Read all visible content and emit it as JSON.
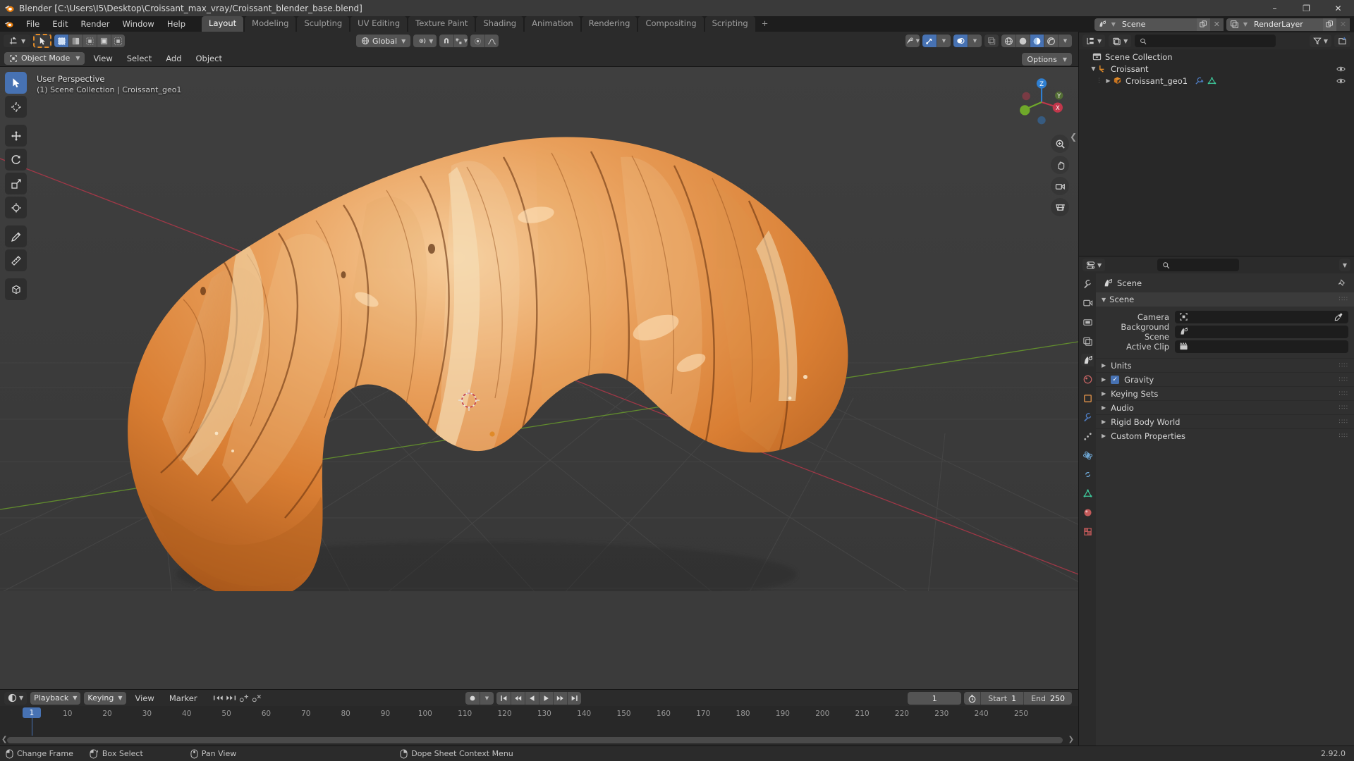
{
  "window": {
    "title": "Blender [C:\\Users\\I5\\Desktop\\Croissant_max_vray/Croissant_blender_base.blend]",
    "minimize": "–",
    "maximize": "❐",
    "close": "✕"
  },
  "menubar": {
    "items": [
      "File",
      "Edit",
      "Render",
      "Window",
      "Help"
    ],
    "tabs": [
      {
        "label": "Layout",
        "active": true
      },
      {
        "label": "Modeling",
        "active": false
      },
      {
        "label": "Sculpting",
        "active": false
      },
      {
        "label": "UV Editing",
        "active": false
      },
      {
        "label": "Texture Paint",
        "active": false
      },
      {
        "label": "Shading",
        "active": false
      },
      {
        "label": "Animation",
        "active": false
      },
      {
        "label": "Rendering",
        "active": false
      },
      {
        "label": "Compositing",
        "active": false
      },
      {
        "label": "Scripting",
        "active": false
      }
    ],
    "add_tab": "+"
  },
  "viewport": {
    "mode": "Object Mode",
    "menus": [
      "View",
      "Select",
      "Add",
      "Object"
    ],
    "transform_orientation": "Global",
    "options_label": "Options",
    "overlay_line1": "User Perspective",
    "overlay_line2": "(1) Scene Collection | Croissant_geo1",
    "gizmo_axes": {
      "x": "X",
      "y": "Y",
      "z": "Z"
    }
  },
  "timeline": {
    "editor_menus": [
      "Playback",
      "Keying",
      "View",
      "Marker"
    ],
    "current_frame": "1",
    "start_label": "Start",
    "start_value": "1",
    "end_label": "End",
    "end_value": "250",
    "playhead_frame": "1",
    "ticks": [
      10,
      20,
      30,
      40,
      50,
      60,
      70,
      80,
      90,
      100,
      110,
      120,
      130,
      140,
      150,
      160,
      170,
      180,
      190,
      200,
      210,
      220,
      230,
      240,
      250
    ]
  },
  "topbar_right": {
    "scene_name": "Scene",
    "view_layer_name": "RenderLayer"
  },
  "outliner": {
    "search_placeholder": "",
    "rows": [
      {
        "label": "Scene Collection",
        "indent": 0,
        "type": "collection",
        "expanded": true,
        "eye": false
      },
      {
        "label": "Croissant",
        "indent": 1,
        "type": "collection-child",
        "expanded": true,
        "eye": true
      },
      {
        "label": "Croissant_geo1",
        "indent": 2,
        "type": "mesh",
        "expanded": false,
        "eye": true
      }
    ]
  },
  "properties": {
    "breadcrumb": "Scene",
    "panel_title": "Scene",
    "fields": [
      {
        "label": "Camera",
        "value": "",
        "icon": "camera-icon"
      },
      {
        "label": "Background Scene",
        "value": "",
        "icon": "scene-icon"
      },
      {
        "label": "Active Clip",
        "value": "",
        "icon": "clip-icon"
      }
    ],
    "sections": [
      {
        "label": "Units",
        "checkbox": null
      },
      {
        "label": "Gravity",
        "checkbox": true
      },
      {
        "label": "Keying Sets",
        "checkbox": null
      },
      {
        "label": "Audio",
        "checkbox": null
      },
      {
        "label": "Rigid Body World",
        "checkbox": null
      },
      {
        "label": "Custom Properties",
        "checkbox": null
      }
    ]
  },
  "statusbar": {
    "items": [
      "Change Frame",
      "Box Select",
      "Pan View",
      "Dope Sheet Context Menu"
    ],
    "version": "2.92.0"
  },
  "colors": {
    "accent": "#4772b3",
    "orange": "#e08a28",
    "axis_x": "#c1374b",
    "axis_y": "#6fa82a",
    "axis_z": "#2f7fd1",
    "bg_dark": "#1d1d1d",
    "bg_panel": "#303030",
    "viewport_bg": "#3b3b3b"
  }
}
